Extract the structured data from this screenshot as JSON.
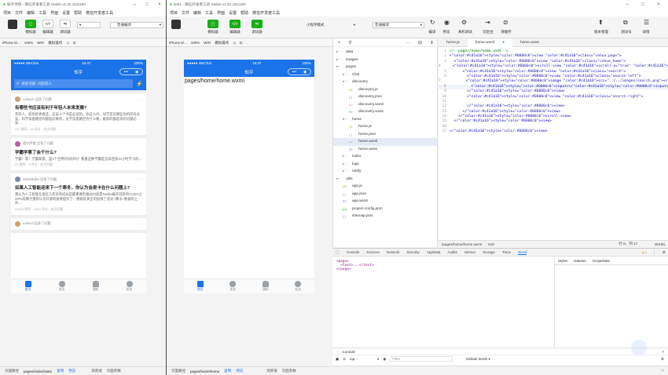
{
  "left_window": {
    "title": "知乎项目 - 微信开发者工具 Stable v1.02.1911180",
    "menu": [
      "项目",
      "文件",
      "编辑",
      "工具",
      "界面",
      "设置",
      "帮助",
      "微信开发者工具"
    ],
    "toolbar": {
      "btn1_label": "模拟器",
      "btn2_label": "编辑器",
      "btn3_label": "调试器",
      "mode_select": "普通编译"
    },
    "simbar": {
      "device": "iPhone 6/...",
      "zoom": "100%",
      "network": "WiFi",
      "operation": "模拟操作"
    },
    "phone": {
      "carrier": "●●●●● WeChat",
      "time": "19:37",
      "battery": "100%",
      "nav_title": "知乎",
      "capsule_dots": "•••",
      "search_placeholder": "搜索话题, 问题或人",
      "items": [
        {
          "author": "Leleuch 回答了问题",
          "title": "有哪些书应该有利于年轻人未来发展?",
          "body": "年轻人，趁你的青春还，应该十个书是必读的。你这么问，同学还有哪些你的所有必读，科学读者路径的都是必要的，文学读者路径为什么要，推荐的都是你的问题必读...",
          "meta": "112 赞同 · 18 评论 · 关注问题"
        },
        {
          "author": "德尔萨斯 回答了问题",
          "title": "学霸学累了会干什么?",
          "body": "学霸！累！学霸和累，是2个世界的词好吗？看看这种学霸是怎样连续24小时学习的...",
          "meta": "23 赞同 · 3 评论 · 关注问题"
        },
        {
          "author": "SilverBullet 回答了问题",
          "title": "如果人工智能迎来下一个寒冬，你认为会是卡在什么问题上?",
          "body": "我认为人工智能在接近几年突然成长是最重要的推动力就是Nvidia展开其新的CUDA之GPU高算力重新认识开源的极致提升了，想她其真正的加快了验证+算法+数据的上升...",
          "meta": "23333 赞同 · 2333 评论 · 关注问题"
        },
        {
          "author": "Leleuch回答了问题",
          "title": "",
          "body": "",
          "meta": ""
        }
      ],
      "tabs": [
        "首页",
        "发现",
        "通知",
        "私信"
      ]
    },
    "footer": {
      "path_label": "页面路径",
      "path": "pages/index/index",
      "copy": "复制",
      "preview": "预览",
      "scene": "场景值",
      "params": "页面参数"
    }
  },
  "right_window": {
    "title": "test1 - 微信开发者工具 Stable v1.02.1911180",
    "menu": [
      "项目",
      "文件",
      "编辑",
      "工具",
      "界面",
      "设置",
      "帮助",
      "微信开发者工具"
    ],
    "toolbar": {
      "btn1_label": "模拟器",
      "btn2_label": "编辑器",
      "btn3_label": "调试器",
      "mode_select": "小程序模式",
      "compile_select": "普通编译",
      "compile": "编译",
      "preview": "预览",
      "realdebug": "真机调试",
      "backend": "切后台",
      "clearcache": "清缓存",
      "version": "版本管理",
      "test": "测试号",
      "detail": "详情"
    },
    "simbar": {
      "device": "iPhone 6/...",
      "zoom": "100%",
      "network": "WiFi",
      "operation": "模拟操作"
    },
    "phone": {
      "carrier": "●●●●● WeChat",
      "time": "19:37",
      "battery": "100%",
      "nav_title": "知乎",
      "capsule_dots": "•••",
      "page_text": "pages/home/home.wxml",
      "tabs": [
        "首页",
        "发现",
        "通知",
        "私信"
      ]
    },
    "tree": [
      {
        "label": "data",
        "type": "folder",
        "indent": 0
      },
      {
        "label": "images",
        "type": "folder",
        "indent": 0
      },
      {
        "label": "pages",
        "type": "folder-open",
        "indent": 0
      },
      {
        "label": "chat",
        "type": "folder",
        "indent": 1
      },
      {
        "label": "discovery",
        "type": "folder-open",
        "indent": 1
      },
      {
        "label": "discovery.js",
        "type": "js",
        "indent": 2
      },
      {
        "label": "discovery.json",
        "type": "json",
        "indent": 2
      },
      {
        "label": "discovery.wxml",
        "type": "wxml",
        "indent": 2
      },
      {
        "label": "discovery.wxss",
        "type": "wxss",
        "indent": 2
      },
      {
        "label": "home",
        "type": "folder-open",
        "indent": 1
      },
      {
        "label": "home.js",
        "type": "js",
        "indent": 2
      },
      {
        "label": "home.json",
        "type": "json",
        "indent": 2
      },
      {
        "label": "home.wxml",
        "type": "wxml",
        "indent": 2,
        "selected": true
      },
      {
        "label": "home.wxss",
        "type": "wxss",
        "indent": 2
      },
      {
        "label": "index",
        "type": "folder",
        "indent": 1
      },
      {
        "label": "logs",
        "type": "folder",
        "indent": 1
      },
      {
        "label": "notify",
        "type": "folder",
        "indent": 1
      },
      {
        "label": "utils",
        "type": "folder-open",
        "indent": 0
      },
      {
        "label": "app.js",
        "type": "js",
        "indent": 1
      },
      {
        "label": "app.json",
        "type": "json",
        "indent": 1
      },
      {
        "label": "app.wxss",
        "type": "wxss",
        "indent": 1
      },
      {
        "label": "project.config.json",
        "type": "cfg",
        "indent": 1
      },
      {
        "label": "sitemap.json",
        "type": "json",
        "indent": 1
      }
    ],
    "editor_tabs": [
      "home.js",
      "home.wxml",
      "home.wxss"
    ],
    "code": [
      "<!--pages/home/home.wxml-->",
      "<view class=\"cehua_page\">",
      "  <view class=\"cehua_home\">",
      "    <scroll-view scroll-y=\"true\" class=\"container\">",
      "      <view class=\"search\">",
      "        <view class=\"search-left\">",
      "          <image src=\"../../images/search.png\"></image>",
      "          <input></input>",
      "        </view>",
      "        <view class=\"search-right\">",
      "",
      "        </view>",
      "      </view>",
      "    </scroll-view>",
      "  </view>",
      "",
      "</view>"
    ],
    "editor_status": {
      "path": "/pages/home/home.wxml",
      "size": "818",
      "position": "行 8，列 17",
      "lang": "WXML"
    },
    "devtools": {
      "tabs": [
        "Console",
        "Sources",
        "Network",
        "Security",
        "AppData",
        "Audits",
        "Sensor",
        "Storage",
        "Trace",
        "Wxml"
      ],
      "active": "Wxml",
      "warn_count": "1",
      "dom": [
        "<page>",
        "  <text>...</text>",
        "</page>"
      ],
      "side_tabs": [
        "Styles",
        "Dataset",
        "ScopeData"
      ],
      "console_label": "Console",
      "context": "top",
      "filter_placeholder": "Filter",
      "levels": "Default levels ▾"
    },
    "footer": {
      "path_label": "页面路径",
      "path": "pages/home/home",
      "copy": "复制",
      "preview": "预览",
      "scene": "场景值",
      "params": "页面参数"
    }
  },
  "colors": {
    "brand_blue": "#1a73e8",
    "wx_green": "#1aad19",
    "search_blue": "#4a8ef0"
  }
}
